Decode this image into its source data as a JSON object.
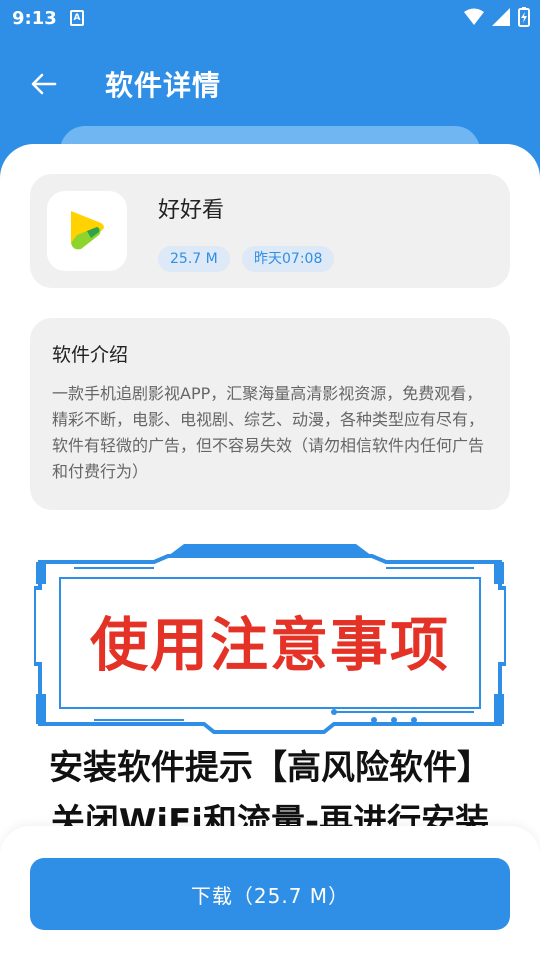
{
  "status_bar": {
    "time": "9:13",
    "notif_letter": "A"
  },
  "header": {
    "title": "软件详情"
  },
  "app": {
    "name": "好好看",
    "size": "25.7 M",
    "updated": "昨天07:08"
  },
  "intro": {
    "title": "软件介绍",
    "text": "一款手机追剧影视APP，汇聚海量高清影视资源，免费观看，精彩不断，电影、电视剧、综艺、动漫，各种类型应有尽有，软件有轻微的广告，但不容易失效（请勿相信软件内任何广告和付费行为）"
  },
  "notice": {
    "heading": "使用注意事项",
    "line1": "安装软件提示【高风险软件】",
    "line2": "关闭WiFi和流量-再进行安装"
  },
  "download": {
    "label": "下载（25.7 M）"
  },
  "colors": {
    "primary": "#2f8fe6",
    "notice_red": "#e53227",
    "card_bg": "#f0f0f0"
  }
}
